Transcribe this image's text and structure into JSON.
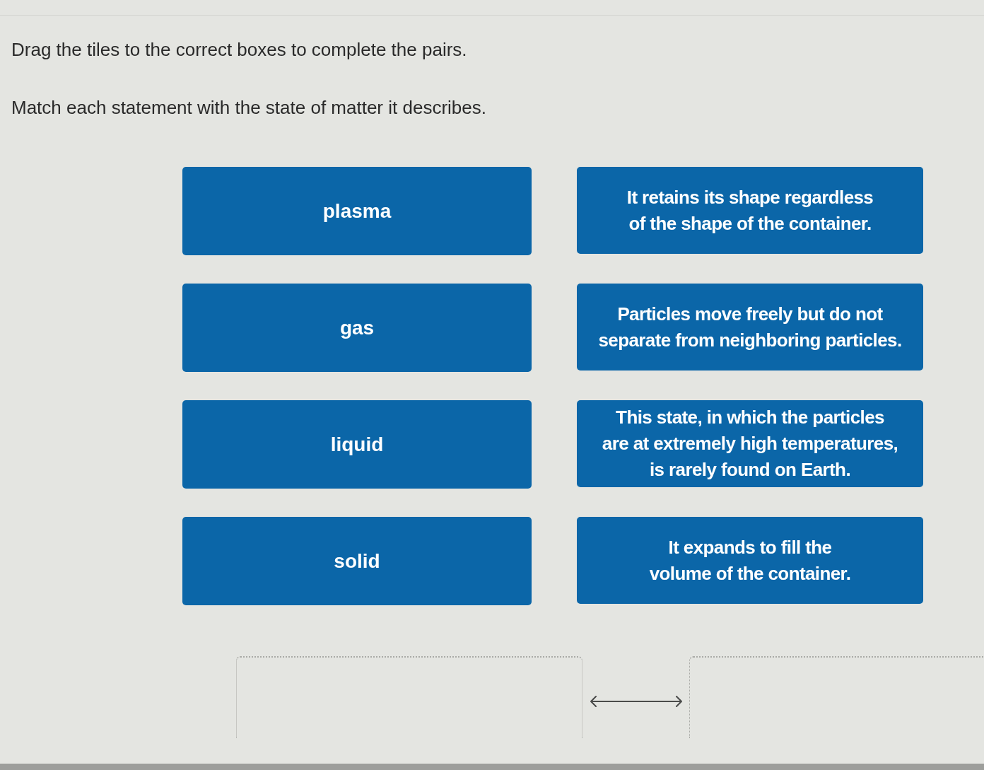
{
  "instructions": [
    "Drag the tiles to the correct boxes to complete the pairs.",
    "Match each statement with the state of matter it describes."
  ],
  "tiles": [
    {
      "term": "plasma",
      "statement": "It retains its shape regardless of the shape of the container."
    },
    {
      "term": "gas",
      "statement": "Particles move freely but do not separate from neighboring particles."
    },
    {
      "term": "liquid",
      "statement": "This state, in which the particles are at extremely high temperatures, is rarely found on Earth."
    },
    {
      "term": "solid",
      "statement": "It expands to fill the volume of the container."
    }
  ]
}
